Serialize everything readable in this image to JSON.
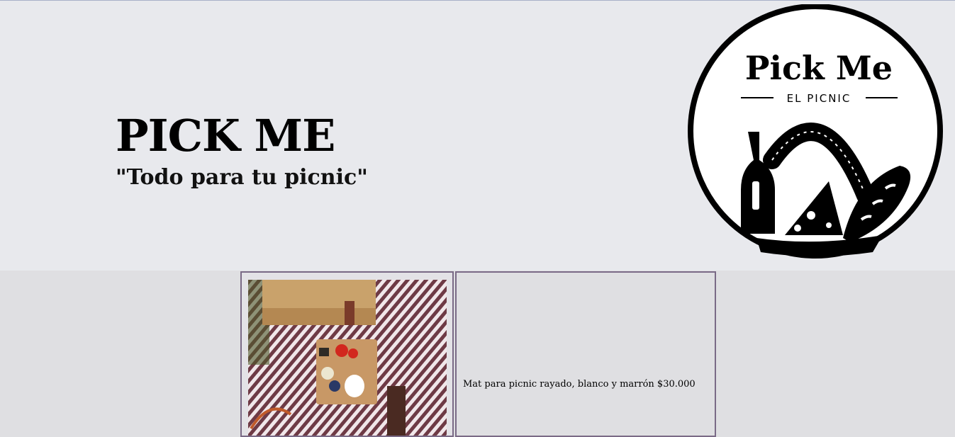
{
  "header": {
    "title": "PICK ME",
    "tagline": "\"Todo para tu picnic\""
  },
  "logo": {
    "wordmark": "Pick Me",
    "subtitle": "EL PICNIC",
    "icon": "picnic-basket-wine-cheese-bread-icon"
  },
  "products": [
    {
      "image_name": "striped-picnic-mat-photo",
      "description": "Mat para picnic rayado, blanco y marrón $30.000"
    }
  ],
  "colors": {
    "header_bg": "#e8e9ed",
    "content_bg": "#dfdfe2",
    "cell_border": "#7a6a86",
    "mat_stripe": "#6e3a45"
  }
}
